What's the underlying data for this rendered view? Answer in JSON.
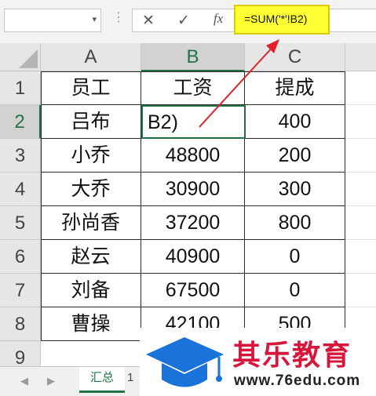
{
  "toolbar": {
    "name_box_value": "",
    "cancel_glyph": "✕",
    "confirm_glyph": "✓",
    "function_glyph": "fx",
    "formula": "=SUM('*'!B2)"
  },
  "columns": [
    "A",
    "B",
    "C"
  ],
  "rows": [
    "1",
    "2",
    "3",
    "4",
    "5",
    "6",
    "7",
    "8",
    "9"
  ],
  "table": [
    [
      "员工",
      "工资",
      "提成"
    ],
    [
      "吕布",
      "B2)",
      "400"
    ],
    [
      "小乔",
      "48800",
      "200"
    ],
    [
      "大乔",
      "30900",
      "300"
    ],
    [
      "孙尚香",
      "37200",
      "800"
    ],
    [
      "赵云",
      "40900",
      "0"
    ],
    [
      "刘备",
      "67500",
      "0"
    ],
    [
      "曹操",
      "42100",
      "500"
    ]
  ],
  "sheet_tabs": [
    "汇总",
    "1"
  ],
  "watermark": {
    "brand": "其乐教育",
    "url": "www.76edu.com"
  },
  "colors": {
    "accent": "#217346",
    "highlight": "#ffff33",
    "arrow": "#e0202a",
    "brand": "#d8163c",
    "cap": "#1a73d8"
  },
  "icons": [
    "chevron-down-icon",
    "ellipsis-icon",
    "cancel-icon",
    "check-icon",
    "function-icon",
    "red-arrow-annotation",
    "graduation-cap-icon"
  ]
}
